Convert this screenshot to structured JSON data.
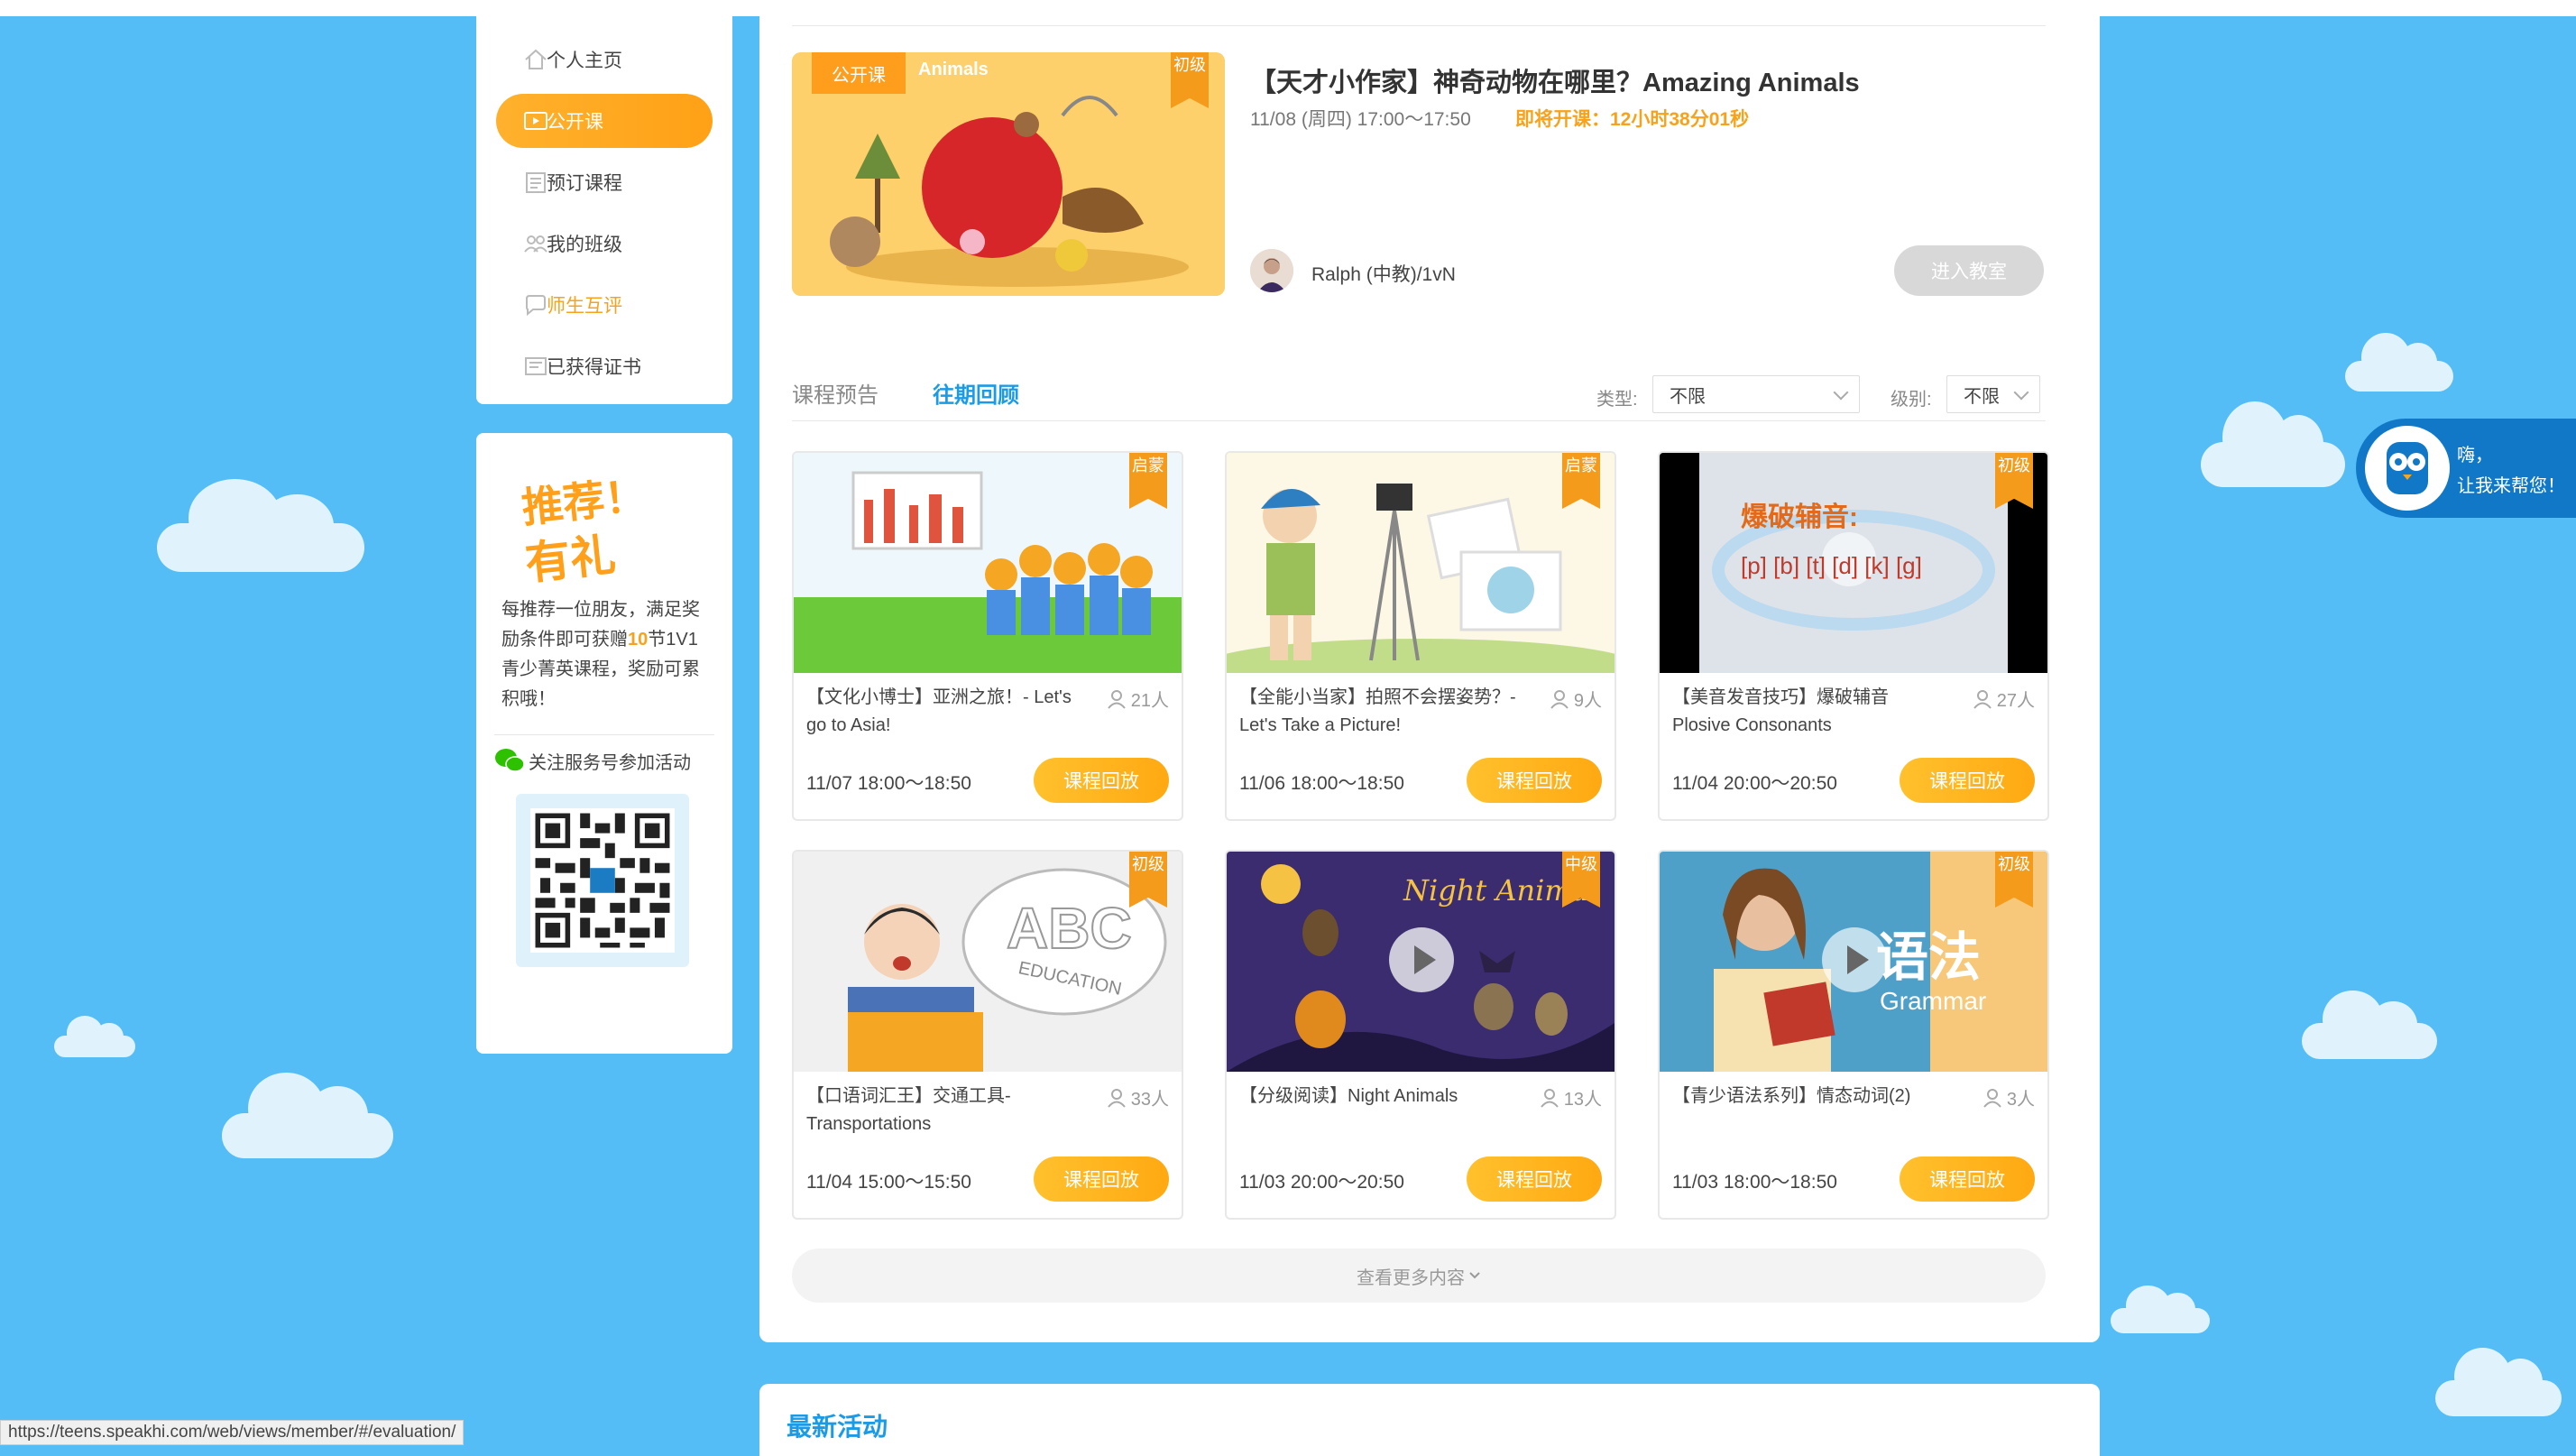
{
  "sidebar": {
    "items": [
      {
        "label": "个人主页",
        "icon": "home-icon",
        "state": "normal"
      },
      {
        "label": "公开课",
        "icon": "tv-icon",
        "state": "active"
      },
      {
        "label": "预订课程",
        "icon": "calendar-icon",
        "state": "normal"
      },
      {
        "label": "我的班级",
        "icon": "group-icon",
        "state": "normal"
      },
      {
        "label": "师生互评",
        "icon": "chat-icon",
        "state": "highlight"
      },
      {
        "label": "已获得证书",
        "icon": "certificate-icon",
        "state": "normal"
      }
    ]
  },
  "promo": {
    "title_line1": "推荐！",
    "title_line2": "有礼",
    "text_pre": "每推荐一位朋友，满足奖励条件即可获赠",
    "text_highlight": "10",
    "text_post": "节1V1青少菁英课程，奖励可累积哦！",
    "wechat_label": "关注服务号参加活动"
  },
  "featured": {
    "tag": "公开课",
    "thumb_text": "Animals",
    "level": "初级",
    "title": "【天才小作家】神奇动物在哪里？Amazing Animals",
    "time": "11/08 (周四) 17:00～17:50",
    "countdown": "即将开课：12小时38分01秒",
    "teacher": "Ralph (中教)/1vN",
    "enter_label": "进入教室"
  },
  "tabs": {
    "upcoming": "课程预告",
    "review": "往期回顾"
  },
  "filters": {
    "type_label": "类型:",
    "type_value": "不限",
    "level_label": "级别:",
    "level_value": "不限"
  },
  "courses": [
    {
      "title": "【文化小博士】亚洲之旅！- Let's go to Asia!",
      "people": "21人",
      "time": "11/07 18:00～18:50",
      "level": "启蒙",
      "button": "课程回放"
    },
    {
      "title": "【全能小当家】拍照不会摆姿势？- Let's Take a Picture!",
      "people": "9人",
      "time": "11/06 18:00～18:50",
      "level": "启蒙",
      "button": "课程回放"
    },
    {
      "title": "【美音发音技巧】爆破辅音 Plosive Consonants",
      "people": "27人",
      "time": "11/04 20:00～20:50",
      "level": "初级",
      "button": "课程回放",
      "thumb_title": "爆破辅音:",
      "thumb_sub": "[p] [b] [t] [d] [k] [g]"
    },
    {
      "title": "【口语词汇王】交通工具-Transportations",
      "people": "33人",
      "time": "11/04 15:00～15:50",
      "level": "初级",
      "button": "课程回放",
      "thumb_title": "ABC",
      "thumb_sub": "EDUCATION"
    },
    {
      "title": "【分级阅读】Night Animals",
      "people": "13人",
      "time": "11/03 20:00～20:50",
      "level": "中级",
      "button": "课程回放",
      "thumb_title": "Night Anima"
    },
    {
      "title": "【青少语法系列】情态动词(2)",
      "people": "3人",
      "time": "11/03 18:00～18:50",
      "level": "初级",
      "button": "课程回放",
      "thumb_title": "语法",
      "thumb_sub": "Grammar"
    }
  ],
  "more_label": "查看更多内容",
  "news_title": "最新活动",
  "status_url": "https://teens.speakhi.com/web/views/member/#/evaluation/",
  "help": {
    "line1": "嗨，",
    "line2": "让我来帮您！"
  },
  "colors": {
    "background": "#55bdf5",
    "accent_orange": "#ffa912",
    "link_blue": "#1b9be6"
  }
}
